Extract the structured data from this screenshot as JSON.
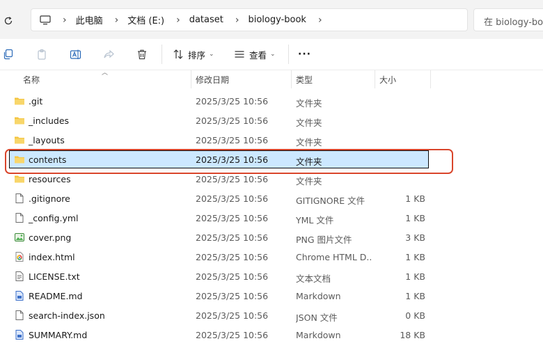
{
  "address_bar": {
    "breadcrumb": [
      "此电脑",
      "文档 (E:)",
      "dataset",
      "biology-book"
    ],
    "search_placeholder": "在 biology-book 中搜索"
  },
  "toolbar": {
    "sort_label": "排序",
    "view_label": "查看",
    "more_label": "···"
  },
  "columns": {
    "name": "名称",
    "date": "修改日期",
    "type": "类型",
    "size": "大小"
  },
  "files": [
    {
      "name": ".git",
      "date": "2025/3/25 10:56",
      "type": "文件夹",
      "size": "",
      "icon": "folder-icon"
    },
    {
      "name": "_includes",
      "date": "2025/3/25 10:56",
      "type": "文件夹",
      "size": "",
      "icon": "folder-icon"
    },
    {
      "name": "_layouts",
      "date": "2025/3/25 10:56",
      "type": "文件夹",
      "size": "",
      "icon": "folder-icon"
    },
    {
      "name": "contents",
      "date": "2025/3/25 10:56",
      "type": "文件夹",
      "size": "",
      "icon": "folder-icon",
      "selected": true
    },
    {
      "name": "resources",
      "date": "2025/3/25 10:56",
      "type": "文件夹",
      "size": "",
      "icon": "folder-icon"
    },
    {
      "name": ".gitignore",
      "date": "2025/3/25 10:56",
      "type": "GITIGNORE 文件",
      "size": "1 KB",
      "icon": "file-icon"
    },
    {
      "name": "_config.yml",
      "date": "2025/3/25 10:56",
      "type": "YML 文件",
      "size": "1 KB",
      "icon": "file-icon"
    },
    {
      "name": "cover.png",
      "date": "2025/3/25 10:56",
      "type": "PNG 图片文件",
      "size": "3 KB",
      "icon": "image-file-icon"
    },
    {
      "name": "index.html",
      "date": "2025/3/25 10:56",
      "type": "Chrome HTML D...",
      "size": "1 KB",
      "icon": "chrome-html-icon"
    },
    {
      "name": "LICENSE.txt",
      "date": "2025/3/25 10:56",
      "type": "文本文档",
      "size": "1 KB",
      "icon": "text-file-icon"
    },
    {
      "name": "README.md",
      "date": "2025/3/25 10:56",
      "type": "Markdown",
      "size": "1 KB",
      "icon": "markdown-file-icon"
    },
    {
      "name": "search-index.json",
      "date": "2025/3/25 10:56",
      "type": "JSON 文件",
      "size": "0 KB",
      "icon": "file-icon"
    },
    {
      "name": "SUMMARY.md",
      "date": "2025/3/25 10:56",
      "type": "Markdown",
      "size": "18 KB",
      "icon": "markdown-file-icon"
    }
  ],
  "colors": {
    "selection": "#cce8ff",
    "highlight_border": "#d9452b",
    "folder": "#f4c542"
  }
}
